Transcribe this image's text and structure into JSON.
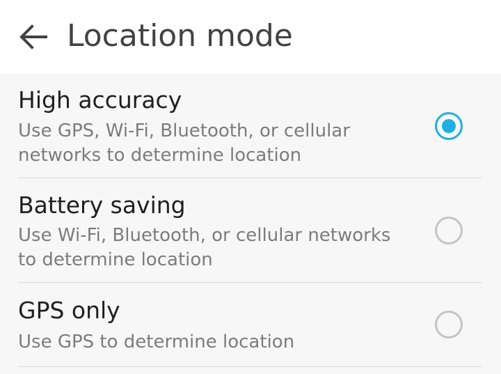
{
  "header": {
    "back_icon": "arrow-back-icon",
    "title": "Location mode"
  },
  "options": [
    {
      "title": "High accuracy",
      "description": "Use GPS, Wi-Fi, Bluetooth, or cellular networks to determine location",
      "selected": true
    },
    {
      "title": "Battery saving",
      "description": "Use Wi-Fi, Bluetooth, or cellular networks to determine location",
      "selected": false
    },
    {
      "title": "GPS only",
      "description": "Use GPS to determine location",
      "selected": false
    }
  ],
  "colors": {
    "accent": "#1db0e3",
    "radio_unselected": "#c4c4c4",
    "title_text": "#424242",
    "option_text": "#1f1f1f",
    "description_text": "#7c7c7c",
    "background": "#f7f7f7",
    "header_background": "#ffffff"
  }
}
